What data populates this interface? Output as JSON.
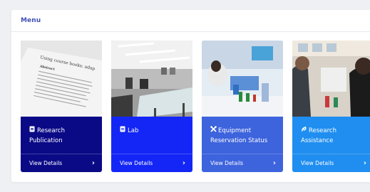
{
  "menu": {
    "title": "Menu"
  },
  "cards": [
    {
      "title_line1": "Research",
      "title_line2": "Publication",
      "action": "View Details",
      "icon": "document-icon",
      "color": "#0a0a87"
    },
    {
      "title_line1": "Lab",
      "title_line2": "",
      "action": "View Details",
      "icon": "document-icon",
      "color": "#1426f5"
    },
    {
      "title_line1": "Equipment",
      "title_line2": "Reservation Status",
      "action": "View Details",
      "icon": "tools-icon",
      "color": "#3d63dd"
    },
    {
      "title_line1": "Research",
      "title_line2": "Assistance",
      "action": "View Details",
      "icon": "seedling-icon",
      "color": "#1f8ef0"
    }
  ]
}
